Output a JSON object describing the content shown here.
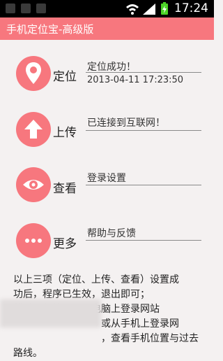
{
  "status_bar": {
    "time": "17:24",
    "icons": [
      "notification-icon",
      "wifi-icon",
      "signal-icon",
      "battery-icon"
    ]
  },
  "header": {
    "title": "手机定位宝-高级版"
  },
  "rows": [
    {
      "icon": "location-pin-icon",
      "label": "定位",
      "text": "定位成功！",
      "subtext": "2013-04-11 17:23:50"
    },
    {
      "icon": "upload-arrow-icon",
      "label": "上传",
      "text": "已连接到互联网！"
    },
    {
      "icon": "eye-icon",
      "label": "查看",
      "text": "登录设置"
    },
    {
      "icon": "more-dots-icon",
      "label": "更多",
      "text": "帮助与反馈"
    }
  ],
  "description": {
    "line1": "以上三项（定位、上传、查看）设置成",
    "line2": "功后，程序已生效，退出即可；",
    "line3": "然后，您就可以从电脑上登录网站",
    "line4": "或从手机上登录网",
    "line5": "，查看手机位置与过去",
    "line6": "路线。"
  },
  "colors": {
    "accent": "#f7777e",
    "background": "#f4f1f1"
  }
}
